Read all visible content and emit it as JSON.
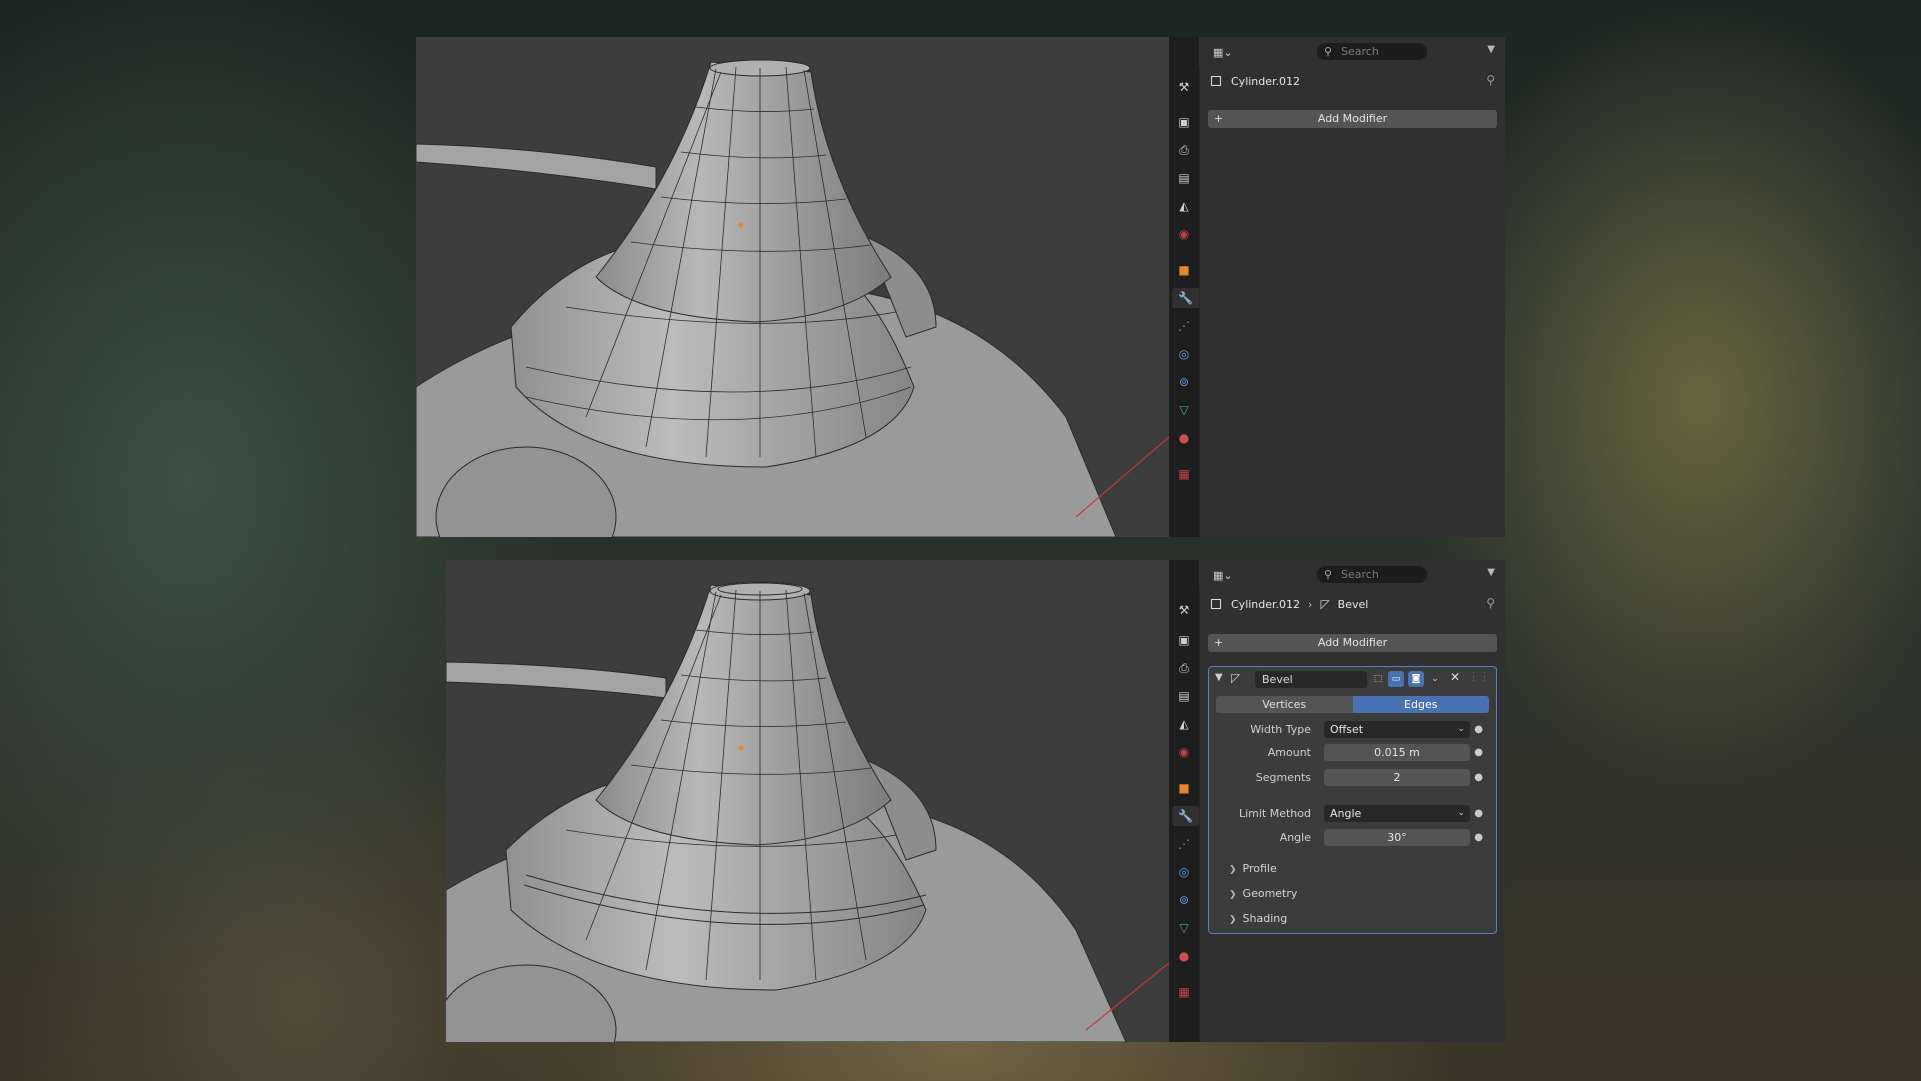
{
  "top": {
    "search_placeholder": "Search",
    "object_name": "Cylinder.012",
    "add_modifier": "Add Modifier"
  },
  "bottom": {
    "search_placeholder": "Search",
    "object_name": "Cylinder.012",
    "modifier_crumb": "Bevel",
    "add_modifier": "Add Modifier",
    "modifier": {
      "name": "Bevel",
      "affect_options": [
        "Vertices",
        "Edges"
      ],
      "affect_selected": "Edges",
      "width_type_label": "Width Type",
      "width_type_value": "Offset",
      "amount_label": "Amount",
      "amount_value": "0.015 m",
      "segments_label": "Segments",
      "segments_value": "2",
      "limit_method_label": "Limit Method",
      "limit_method_value": "Angle",
      "angle_label": "Angle",
      "angle_value": "30°",
      "subpanels": [
        "Profile",
        "Geometry",
        "Shading"
      ]
    }
  },
  "property_tabs": [
    "tool",
    "render",
    "output",
    "view-layer",
    "scene",
    "world",
    "object",
    "modifiers",
    "particles",
    "physics",
    "constraints",
    "data",
    "material",
    "texture"
  ],
  "active_tab": "modifiers",
  "colors": {
    "accent_blue": "#4772b3",
    "panel_outline": "#5680c2",
    "vertex_orange": "#e8862a",
    "axis_red": "#c8373c"
  }
}
